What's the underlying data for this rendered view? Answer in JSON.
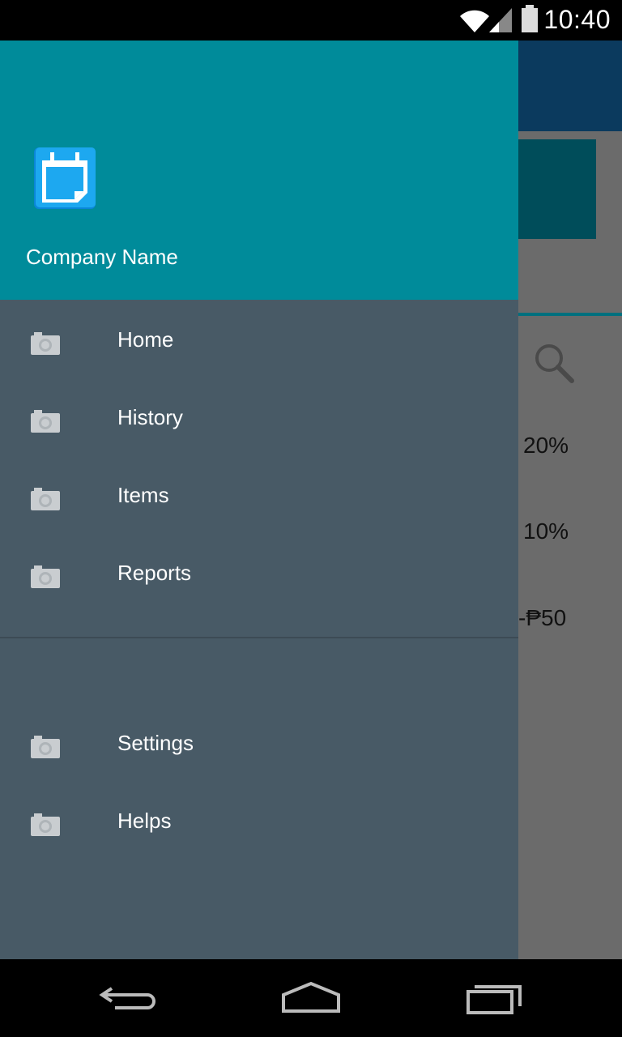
{
  "status_bar": {
    "time": "10:40",
    "icons": [
      "wifi-icon",
      "signal-icon",
      "battery-icon"
    ]
  },
  "background": {
    "values": [
      "20%",
      "10%",
      "-₱50"
    ],
    "search_icon": "search-icon",
    "colors": {
      "toolbar": "#0b3a5e",
      "card": "#004d5a",
      "scrim": "#6b6b6b"
    }
  },
  "drawer": {
    "header": {
      "company_name": "Company Name",
      "logo_icon": "calendar-note-icon",
      "background": "#008b9a"
    },
    "primary_items": [
      {
        "label": "Home",
        "icon": "camera-icon"
      },
      {
        "label": "History",
        "icon": "camera-icon"
      },
      {
        "label": "Items",
        "icon": "camera-icon"
      },
      {
        "label": "Reports",
        "icon": "camera-icon"
      }
    ],
    "secondary_items": [
      {
        "label": "Settings",
        "icon": "camera-icon"
      },
      {
        "label": "Helps",
        "icon": "camera-icon"
      }
    ],
    "background": "#485a66"
  },
  "nav_bar": {
    "buttons": [
      "back-icon",
      "home-icon",
      "recents-icon"
    ]
  }
}
